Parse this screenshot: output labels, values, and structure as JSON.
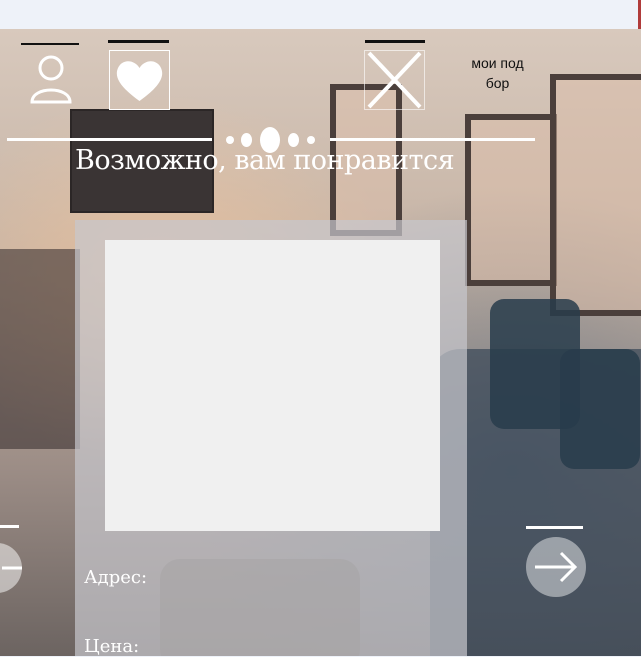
{
  "header": {
    "profile_icon": "user-icon",
    "favorites_icon": "heart-icon",
    "close_icon": "close-icon",
    "my_picks_label": "мои подбор"
  },
  "main": {
    "title": "Возможно, вам понравится",
    "card": {
      "address_label": "Адрес:",
      "price_label": "Цена:"
    }
  },
  "nav": {
    "prev_icon": "arrow-left-icon",
    "next_icon": "arrow-right-icon"
  },
  "colors": {
    "accent": "#ffffff",
    "topbar": "#eef2f9",
    "topbar_accent": "#b03b3b"
  }
}
